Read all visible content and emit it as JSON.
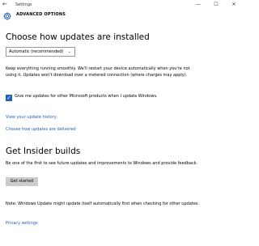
{
  "window": {
    "title": "Settings",
    "back_icon": "back-arrow-icon",
    "minimize_glyph": "—",
    "maximize_glyph": "☐",
    "close_glyph": "✕"
  },
  "header": {
    "title": "ADVANCED OPTIONS",
    "icon": "gear-icon",
    "accent_color": "#1f5fb8"
  },
  "updates": {
    "heading": "Choose how updates are installed",
    "dropdown_value": "Automatic (recommended)",
    "description": "Keep everything running smoothly. We'll restart your device automatically when you're not using it. Updates won't download over a metered connection (where charges may apply).",
    "checkbox_checked": true,
    "checkbox_label": "Give me updates for other Microsoft products when I update Windows.",
    "history_link": "View your update history",
    "delivery_link": "Choose how updates are delivered"
  },
  "insider": {
    "heading": "Get Insider builds",
    "description": "Be one of the first to see future updates and improvements to Windows and provide feedback.",
    "button_label": "Get started",
    "note": "Note: Windows Update might update itself automatically first when checking for other updates.",
    "privacy_link": "Privacy settings"
  }
}
